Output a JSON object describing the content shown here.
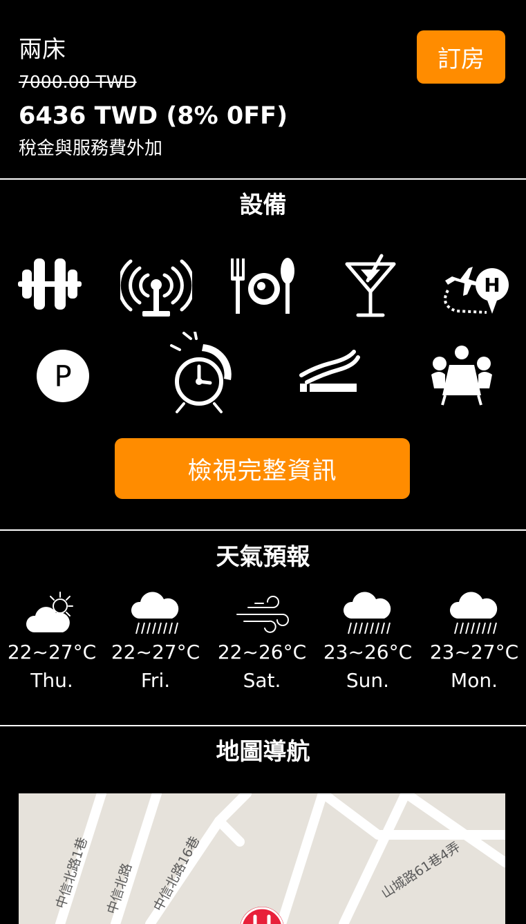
{
  "room": {
    "name": "兩床",
    "original_price": "7000.00 TWD",
    "discount_price": "6436 TWD (8% 0FF)",
    "tax_note": "稅金與服務費外加",
    "book_label": "訂房"
  },
  "facilities": {
    "title": "設備",
    "icons": [
      "gym-icon",
      "wifi-icon",
      "restaurant-icon",
      "bar-icon",
      "airport-shuttle-icon",
      "parking-icon",
      "wake-up-call-icon",
      "smoking-area-icon",
      "meeting-room-icon"
    ],
    "button_label": "檢視完整資訊"
  },
  "weather": {
    "title": "天氣預報",
    "days": [
      {
        "temp": "22~27°C",
        "day": "Thu.",
        "icon": "partly-cloudy-icon"
      },
      {
        "temp": "22~27°C",
        "day": "Fri.",
        "icon": "rain-icon"
      },
      {
        "temp": "22~26°C",
        "day": "Sat.",
        "icon": "wind-icon"
      },
      {
        "temp": "23~26°C",
        "day": "Sun.",
        "icon": "rain-icon"
      },
      {
        "temp": "23~27°C",
        "day": "Mon.",
        "icon": "rain-icon"
      }
    ]
  },
  "map": {
    "title": "地圖導航",
    "streets": [
      "中信北路1巷",
      "中信北路",
      "中信北路16巷",
      "山城路61巷4弄"
    ]
  },
  "colors": {
    "accent": "#ff8c00",
    "background": "#000000",
    "map_background": "#e6e2db",
    "map_pin": "#e8203a"
  }
}
